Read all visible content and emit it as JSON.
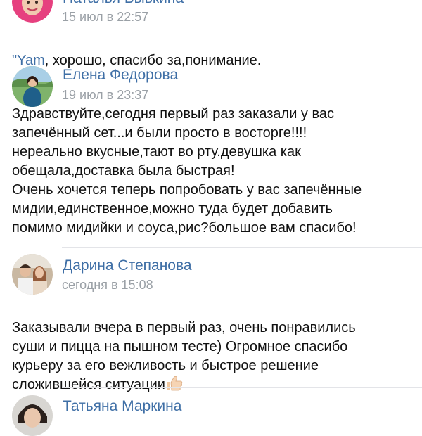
{
  "comments": [
    {
      "author": "Наталья Бывкина",
      "time": "15 июл в 22:57",
      "quote": "\"Yam",
      "text": ", хорошо, спасибо за,понимание."
    },
    {
      "author": "Елена Федорова",
      "time": "19 июл в 23:37",
      "text": "Здравствуйте,сегодня первый раз заказали у вас\nзапечённый сет...и были просто в восторге!!!!\nнереально вкусные,тают во рту.девушка как\nобещала,доставка была быстрая!\nОчень хочется теперь попробовать у вас запечённые\nмидии,единственное,можно туда будет добавить\nпомимо мидийки и соуса,рис?большое вам спасибо!"
    },
    {
      "author": "Дарина Степанова",
      "time": "сегодня в 15:08",
      "text": "Заказывали вчера в первый раз, очень понравились\nсуши и пицца на пышном тесте) Огромное спасибо\nкурьеру за его вежливость и быстрое решение\nсложившейся ситуации",
      "emoji": "thumbs-up-icon"
    },
    {
      "author": "Татьяна Маркина"
    }
  ],
  "colors": {
    "author": "#3f6fa6",
    "meta": "#9aa0a6",
    "text": "#111111",
    "divider": "#e3e4e8"
  }
}
